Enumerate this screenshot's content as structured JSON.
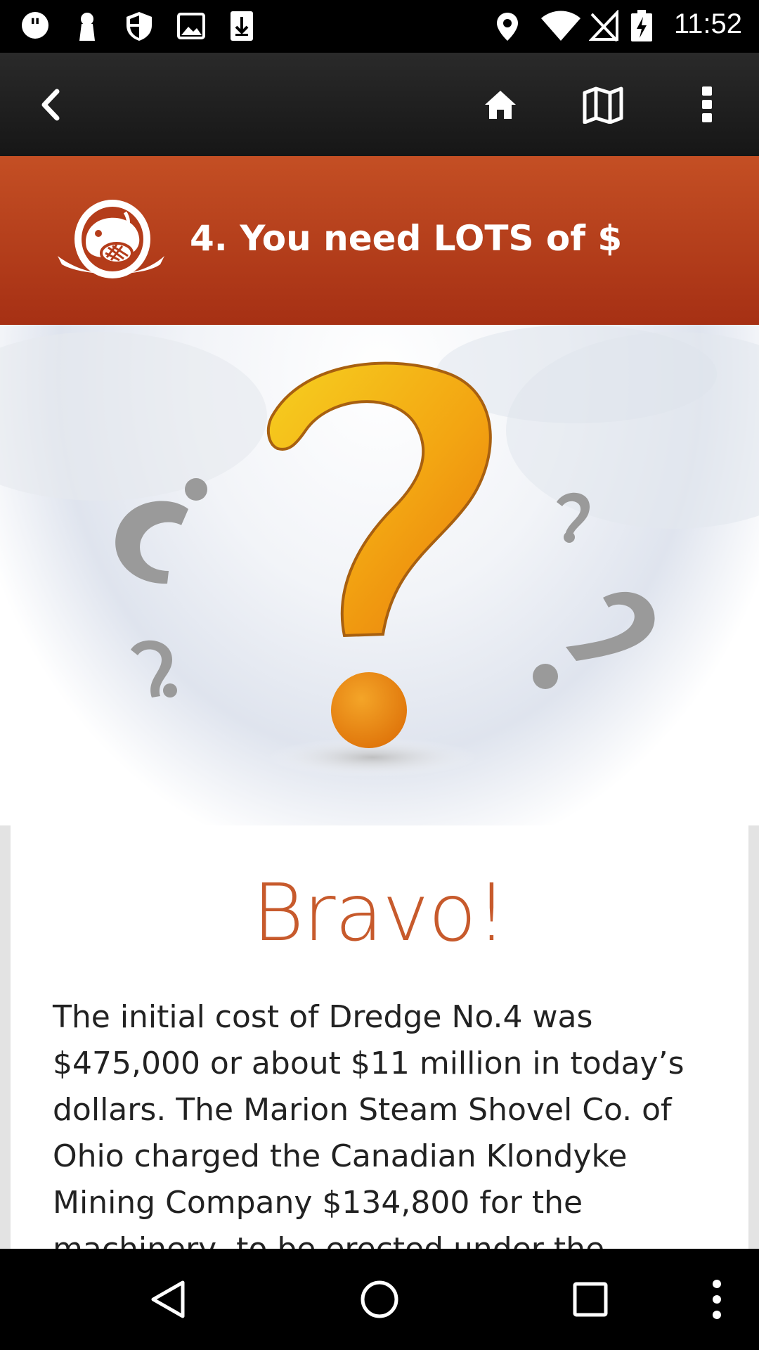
{
  "status_bar": {
    "time": "11:52",
    "left_icons": [
      "quote-notification-icon",
      "keyhole-notification-icon",
      "shield-notification-icon",
      "image-notification-icon",
      "download-notification-icon"
    ],
    "right_icons": [
      "location-icon",
      "wifi-icon",
      "no-signal-icon",
      "battery-charging-icon"
    ]
  },
  "toolbar": {
    "icons": [
      "back-icon",
      "home-icon",
      "map-icon",
      "overflow-menu-icon"
    ]
  },
  "header": {
    "title": "4. You need LOTS of $",
    "logo_icon": "beaver-logo-icon"
  },
  "hero": {
    "image": "question-marks-illustration",
    "colors": {
      "main_question": "#f0a010",
      "grey_questions": "#9a9a9a"
    }
  },
  "content": {
    "heading": "Bravo!",
    "body": "The initial cost of Dredge No.4 was $475,000 or about $11 million in today’s dollars. The Marion Steam Shovel Co. of Ohio charged the Canadian Klondyke Mining Company $134,800 for the machinery, to be erected under the"
  },
  "nav_bar": {
    "icons": [
      "nav-back-icon",
      "nav-home-icon",
      "nav-recents-icon",
      "nav-menu-icon"
    ]
  },
  "colors": {
    "header_top": "#c44f24",
    "header_bottom": "#a63014",
    "heading_accent": "#c75a2c"
  }
}
